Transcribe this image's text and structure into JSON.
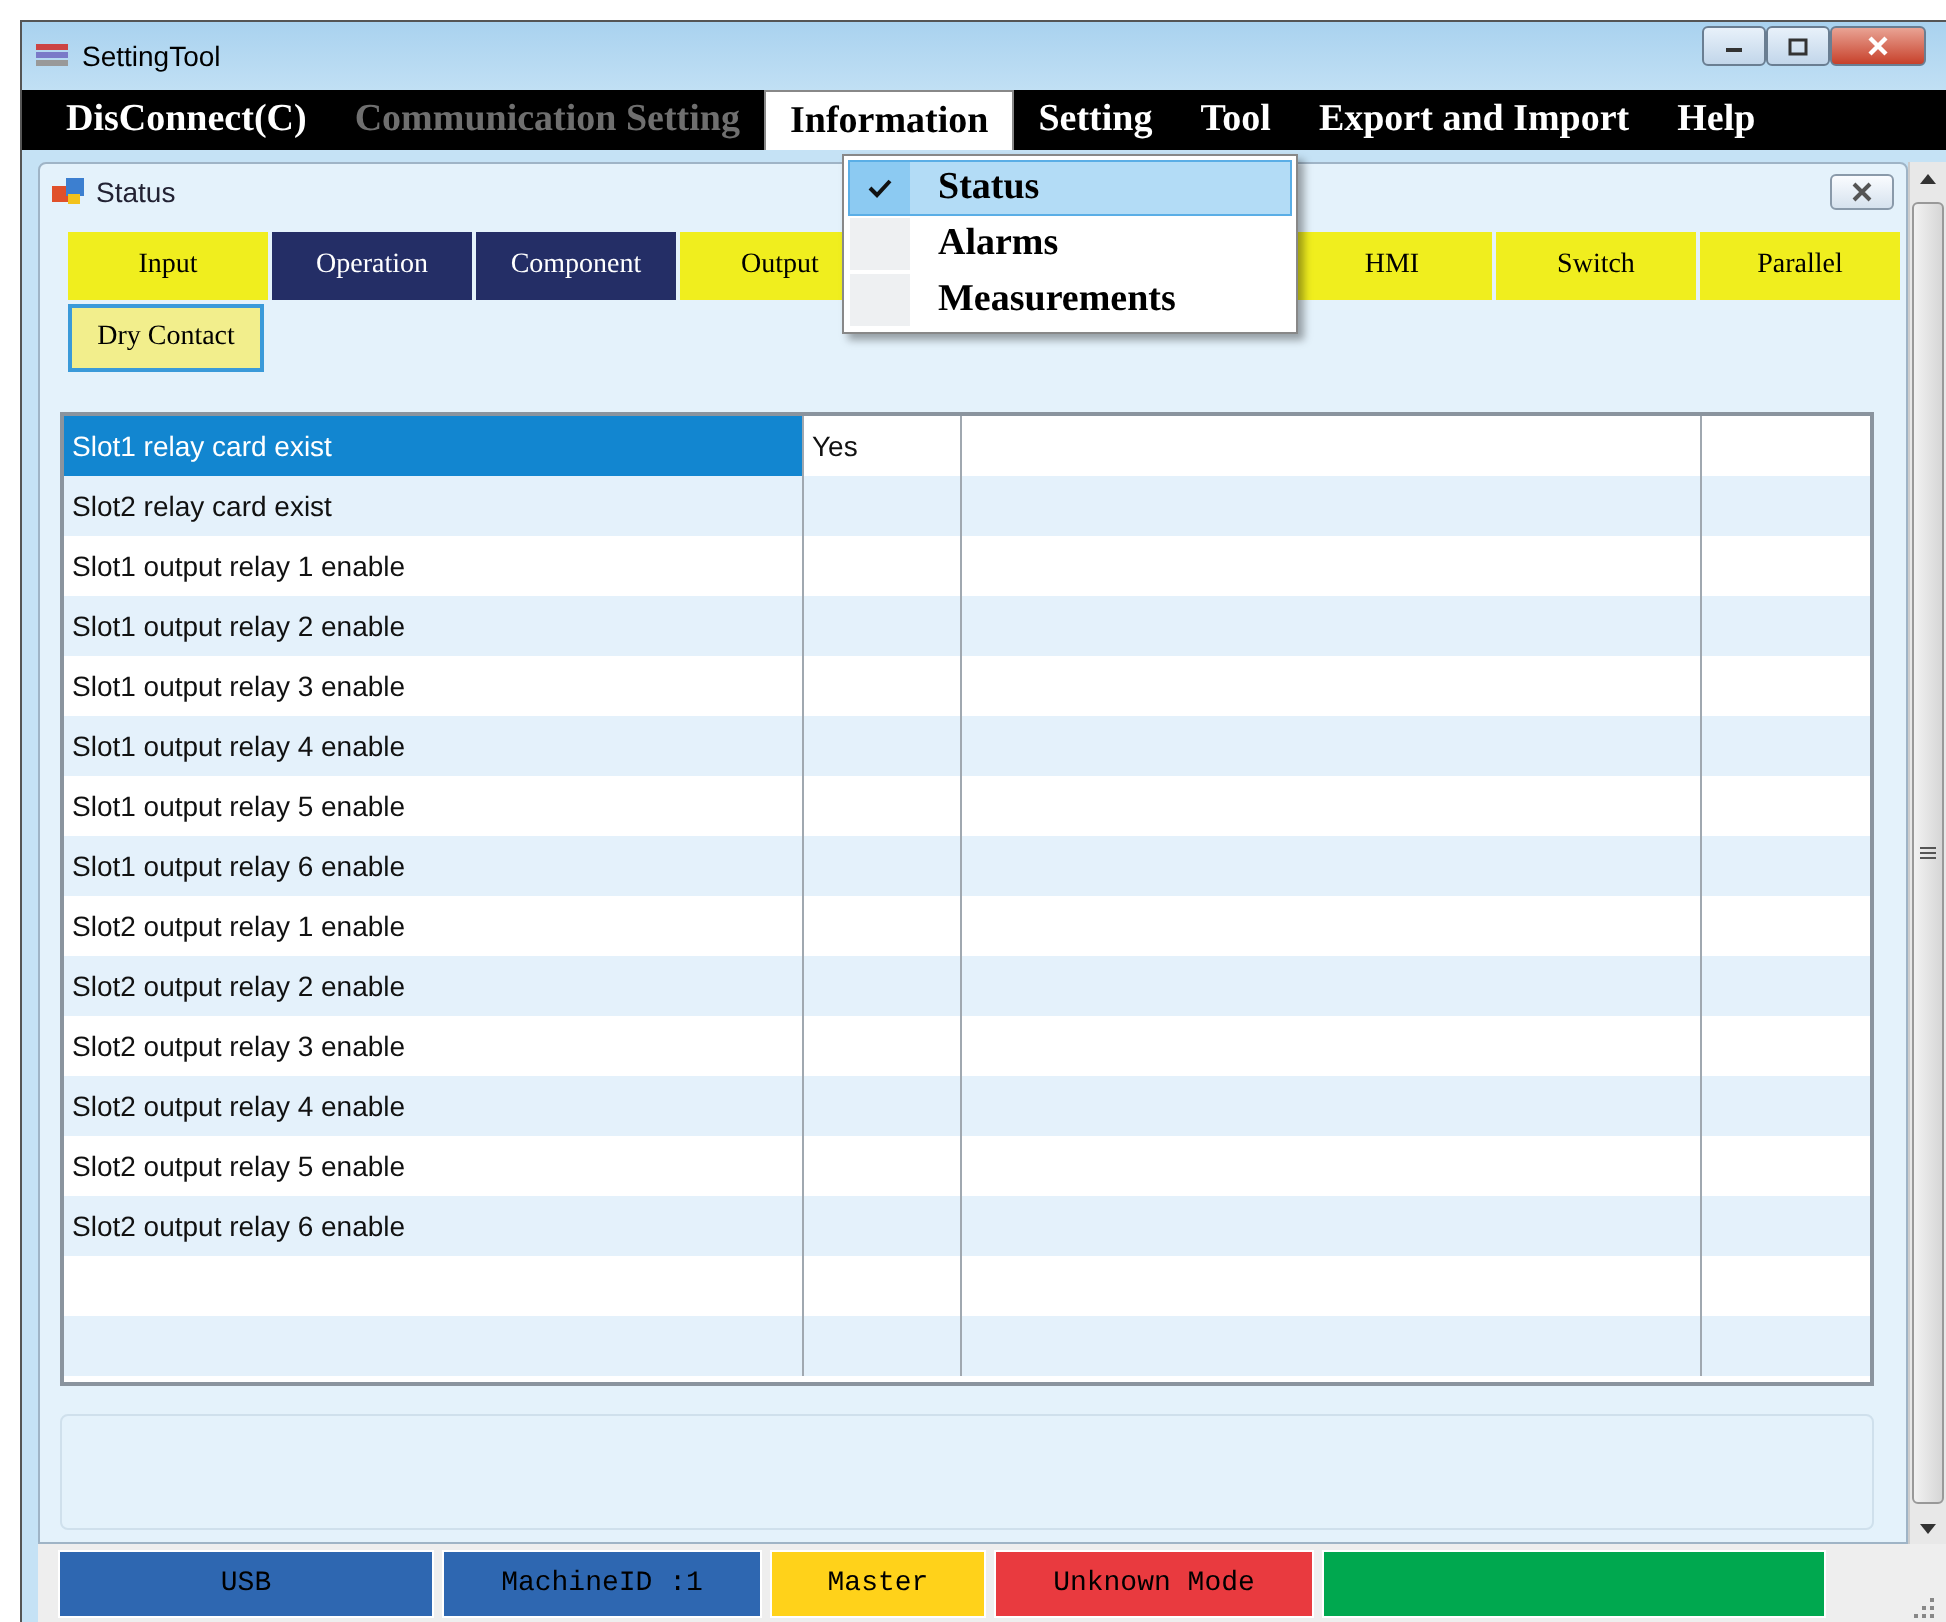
{
  "window": {
    "title": "SettingTool"
  },
  "menu_bar": [
    {
      "label": "DisConnect(C)",
      "disabled": false,
      "selected": false
    },
    {
      "label": "Communication Setting",
      "disabled": true,
      "selected": false
    },
    {
      "label": "Information",
      "disabled": false,
      "selected": true
    },
    {
      "label": "Setting",
      "disabled": false,
      "selected": false
    },
    {
      "label": "Tool",
      "disabled": false,
      "selected": false
    },
    {
      "label": "Export and Import",
      "disabled": false,
      "selected": false
    },
    {
      "label": "Help",
      "disabled": false,
      "selected": false
    }
  ],
  "dropdown": [
    {
      "label": "Status",
      "checked": true,
      "selected": true
    },
    {
      "label": "Alarms",
      "checked": false,
      "selected": false
    },
    {
      "label": "Measurements",
      "checked": false,
      "selected": false
    }
  ],
  "child_window": {
    "title": "Status"
  },
  "tabs": [
    {
      "label": "Input",
      "color": "#f0ee1e",
      "selected": false
    },
    {
      "label": "Operation",
      "color": "#242e66",
      "selected": false
    },
    {
      "label": "Component",
      "color": "#242e66",
      "selected": false
    },
    {
      "label": "Output",
      "color": "#f0ee1e",
      "selected": false
    },
    {
      "label": "HMI",
      "color": "#f0ee1e",
      "selected": false
    },
    {
      "label": "Switch",
      "color": "#f0ee1e",
      "selected": false
    },
    {
      "label": "Parallel",
      "color": "#f0ee1e",
      "selected": false
    },
    {
      "label": "Dry Contact",
      "color": "#f2ee8c",
      "selected": true
    }
  ],
  "table": {
    "rows": [
      {
        "name": "Slot1 relay card exist",
        "value": "Yes",
        "selected": true
      },
      {
        "name": "Slot2 relay card exist",
        "selected": false
      },
      {
        "name": "Slot1 output relay 1 enable",
        "selected": false
      },
      {
        "name": "Slot1 output relay 2 enable",
        "selected": false
      },
      {
        "name": "Slot1 output relay 3 enable",
        "selected": false
      },
      {
        "name": "Slot1 output relay 4 enable",
        "selected": false
      },
      {
        "name": "Slot1 output relay 5 enable",
        "selected": false
      },
      {
        "name": "Slot1 output relay 6 enable",
        "selected": false
      },
      {
        "name": "Slot2 output relay 1 enable",
        "selected": false
      },
      {
        "name": "Slot2 output relay 2 enable",
        "selected": false
      },
      {
        "name": "Slot2 output relay 3 enable",
        "selected": false
      },
      {
        "name": "Slot2 output relay 4 enable",
        "selected": false
      },
      {
        "name": "Slot2 output relay 5 enable",
        "selected": false
      },
      {
        "name": "Slot2 output relay 6 enable",
        "selected": false
      }
    ]
  },
  "status_bar": [
    {
      "text": "USB",
      "color": "#2e67b1"
    },
    {
      "text": "MachineID :1",
      "color": "#2e67b1"
    },
    {
      "text": "Master",
      "color": "#ffd21a"
    },
    {
      "text": "Unknown Mode",
      "color": "#e93a3f"
    },
    {
      "color": "#00a84f"
    }
  ]
}
